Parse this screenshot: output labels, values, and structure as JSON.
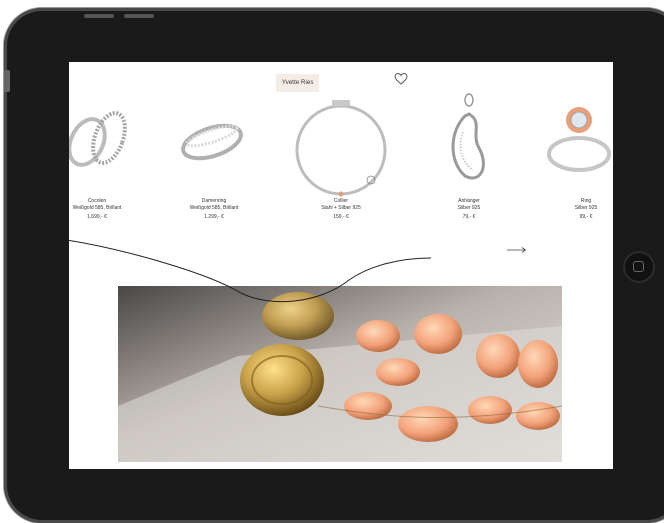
{
  "tag": {
    "label": "Yvette Ries"
  },
  "products": [
    {
      "name": "Cocolen",
      "desc": "Weißgold 585, Brillant",
      "price": "1.699,- €"
    },
    {
      "name": "Damenring",
      "desc": "Weißgold 585, Brillant",
      "price": "1.299,- €"
    },
    {
      "name": "Collier",
      "desc": "Stahl + Silber 925",
      "price": "159,- €"
    },
    {
      "name": "Anhänger",
      "desc": "Silber 925",
      "price": "79,- €"
    },
    {
      "name": "Ring",
      "desc": "Silber 925",
      "price": "99,- €"
    }
  ],
  "icons": {
    "favorite": "heart-icon",
    "next": "arrow-right-icon",
    "home": "home-button-icon"
  },
  "colors": {
    "tag_bg": "#f3ede6",
    "bezel": "#1a1a1a",
    "gold": "#c9a24a",
    "coral": "#f2a27a"
  }
}
